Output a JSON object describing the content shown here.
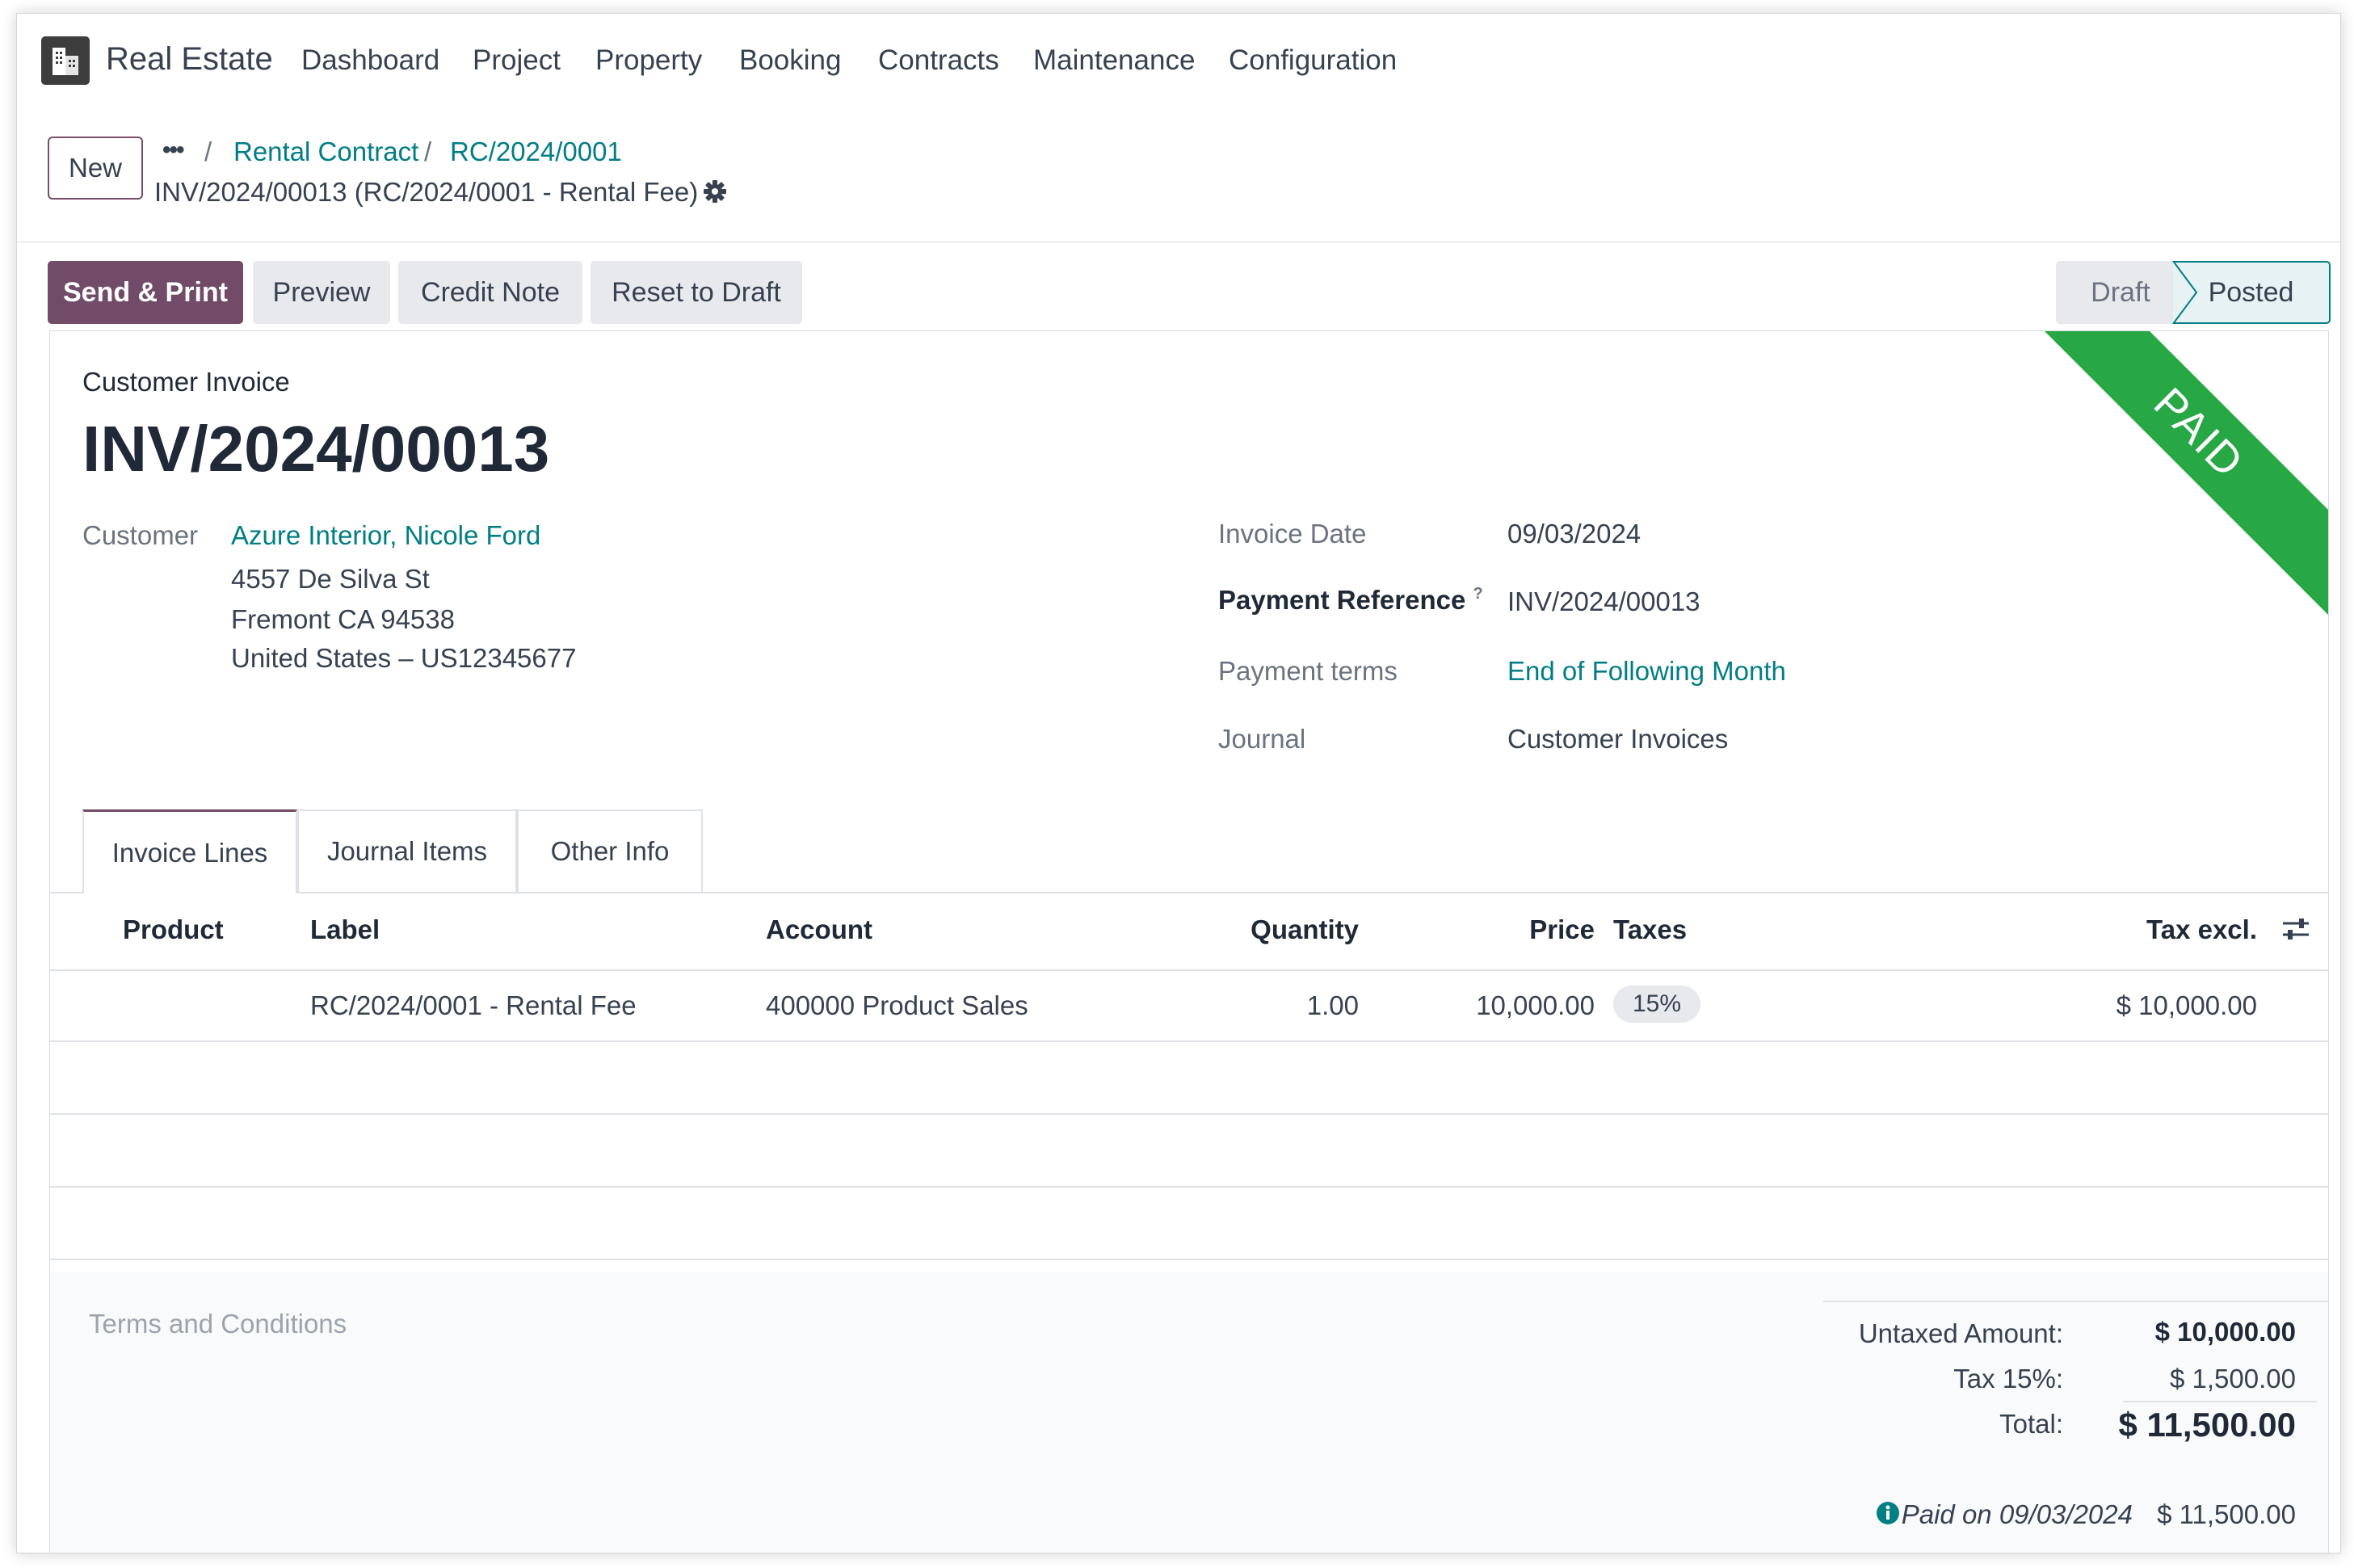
{
  "navbar": {
    "app_name": "Real Estate",
    "items": [
      "Dashboard",
      "Project",
      "Property",
      "Booking",
      "Contracts",
      "Maintenance",
      "Configuration"
    ]
  },
  "control_panel": {
    "new_label": "New",
    "more_label": "•••",
    "breadcrumbs": [
      "Rental Contract",
      "RC/2024/0001"
    ],
    "record_name": "INV/2024/00013 (RC/2024/0001 - Rental Fee)"
  },
  "actions": {
    "send_print": "Send & Print",
    "preview": "Preview",
    "credit_note": "Credit Note",
    "reset_to_draft": "Reset to Draft"
  },
  "status": {
    "steps": [
      "Draft",
      "Posted"
    ],
    "current": "Posted"
  },
  "ribbon": "PAID",
  "invoice": {
    "type": "Customer Invoice",
    "name": "INV/2024/00013",
    "customer_label": "Customer",
    "customer_name": "Azure Interior, Nicole Ford",
    "address": [
      "4557 De Silva St",
      "Fremont CA 94538",
      "United States – US12345677"
    ],
    "date_label": "Invoice Date",
    "date": "09/03/2024",
    "payment_ref_label": "Payment Reference",
    "payment_ref_help": "?",
    "payment_ref": "INV/2024/00013",
    "payment_terms_label": "Payment terms",
    "payment_terms": "End of Following Month",
    "journal_label": "Journal",
    "journal": "Customer Invoices"
  },
  "tabs": [
    "Invoice Lines",
    "Journal Items",
    "Other Info"
  ],
  "table": {
    "columns": [
      "Product",
      "Label",
      "Account",
      "Quantity",
      "Price",
      "Taxes",
      "Tax excl."
    ],
    "rows": [
      {
        "product": "",
        "label": "RC/2024/0001 - Rental Fee",
        "account": "400000 Product Sales",
        "quantity": "1.00",
        "price": "10,000.00",
        "taxes": "15%",
        "subtotal": "$ 10,000.00"
      }
    ]
  },
  "footer": {
    "terms_placeholder": "Terms and Conditions",
    "untaxed_label": "Untaxed Amount:",
    "untaxed_value": "$ 10,000.00",
    "tax_label": "Tax 15%:",
    "tax_value": "$ 1,500.00",
    "total_label": "Total:",
    "total_value": "$ 11,500.00",
    "paid_label": "Paid on 09/03/2024",
    "paid_value": "$ 11,500.00"
  },
  "colors": {
    "primary": "#714b67",
    "link": "#017e84",
    "ribbon": "#28a745"
  }
}
